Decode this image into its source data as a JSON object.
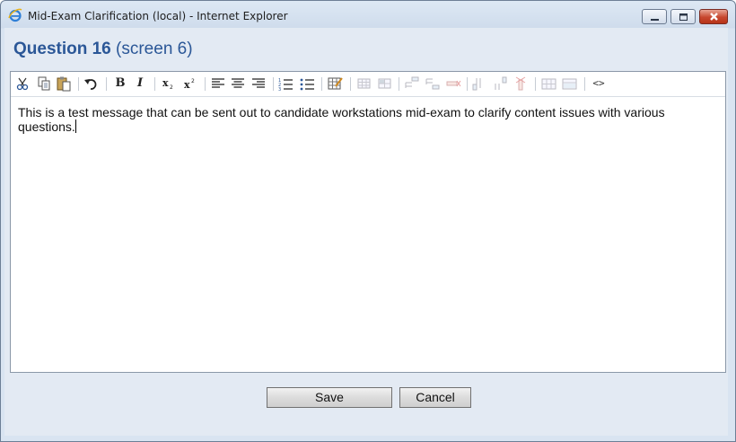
{
  "window": {
    "title": "Mid-Exam Clarification (local) - Internet Explorer"
  },
  "dialog": {
    "title_main": "Question 16",
    "title_sub": "(screen 6)"
  },
  "toolbar": {
    "icons": [
      "cut-icon",
      "copy-icon",
      "paste-icon",
      "undo-icon",
      "bold-icon",
      "italic-icon",
      "subscript-icon",
      "superscript-icon",
      "align-left-icon",
      "align-center-icon",
      "align-right-icon",
      "ordered-list-icon",
      "unordered-list-icon",
      "insert-table-icon",
      "table-props-icon",
      "cell-props-icon",
      "insert-row-before-icon",
      "insert-row-after-icon",
      "delete-row-icon",
      "insert-col-before-icon",
      "insert-col-after-icon",
      "delete-col-icon",
      "split-cells-icon",
      "merge-cells-icon",
      "code-view-icon"
    ],
    "bold_glyph": "B",
    "italic_glyph": "I",
    "code_glyph": "<>"
  },
  "editor": {
    "text": "This is a test message that can be sent out to candidate workstations mid-exam to clarify content issues with various questions."
  },
  "buttons": {
    "save": "Save",
    "cancel": "Cancel"
  },
  "colors": {
    "title_blue": "#2b5797",
    "close_red": "#c7472f"
  }
}
